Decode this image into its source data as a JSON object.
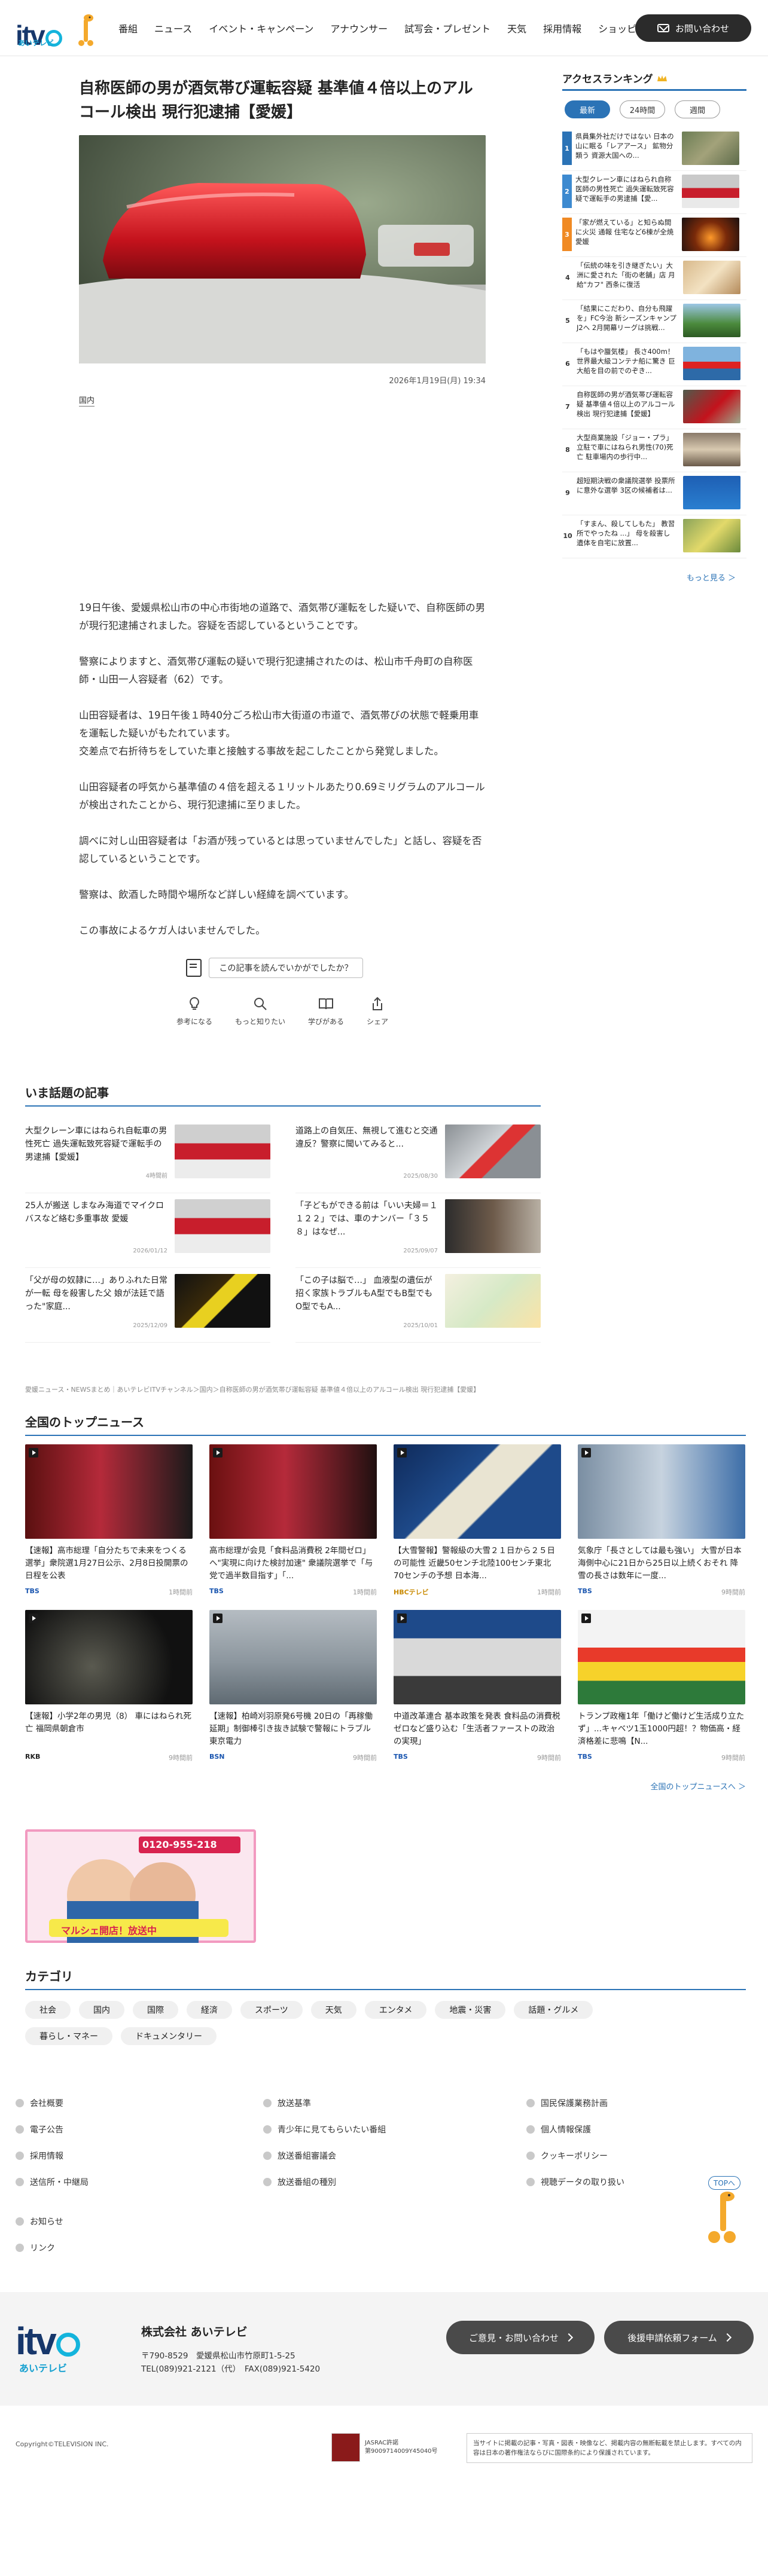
{
  "header": {
    "logo_text": "itv",
    "logo_sub": "あいテレビ",
    "nav": [
      "番組",
      "ニュース",
      "イベント・キャンペーン",
      "アナウンサー",
      "試写会・プレゼント",
      "天気",
      "採用情報",
      "ショッピング"
    ],
    "contact_label": "お問い合わせ"
  },
  "article": {
    "title": "自称医師の男が酒気帯び運転容疑 基準値４倍以上のアルコール検出 現行犯逮捕【愛媛】",
    "date": "2026年1月19日(月) 19:34",
    "category": "国内",
    "paragraphs": [
      "19日午後、愛媛県松山市の中心市街地の道路で、酒気帯び運転をした疑いで、自称医師の男が現行犯逮捕されました。容疑を否認しているということです。",
      "警察によりますと、酒気帯び運転の疑いで現行犯逮捕されたのは、松山市千舟町の自称医師・山田一人容疑者（62）です。",
      "山田容疑者は、19日午後１時40分ごろ松山市大街道の市道で、酒気帯びの状態で軽乗用車を運転した疑いがもたれています。\n交差点で右折待ちをしていた車と接触する事故を起こしたことから発覚しました。",
      "山田容疑者の呼気から基準値の４倍を超える１リットルあたり0.69ミリグラムのアルコールが検出されたことから、現行犯逮捕に至りました。",
      "調べに対し山田容疑者は「お酒が残っているとは思っていませんでした」と話し、容疑を否認しているということです。",
      "警察は、飲酒した時間や場所など詳しい経緯を調べています。",
      "この事故によるケガ人はいませんでした。"
    ],
    "feedback_question": "この記事を読んでいかがでしたか？",
    "feedback_options": [
      "参考になる",
      "もっと知りたい",
      "学びがある",
      "シェア"
    ]
  },
  "sidebar": {
    "title": "アクセスランキング",
    "tabs": [
      "最新",
      "24時間",
      "週間"
    ],
    "ranking": [
      {
        "num": "1",
        "text": "県員集外社だけではない 日本の山に眠る「レアアース」 鉱物分類う 資源大国への..."
      },
      {
        "num": "2",
        "text": "大型クレーン車にはねられ自称医師の男性死亡 過失運転致死容疑で運転手の男逮捕【愛..."
      },
      {
        "num": "3",
        "text": "「家が燃えている」と知らぬ間に火災 通報 住宅など6棟が全焼 愛媛"
      },
      {
        "num": "4",
        "text": "「伝統の味を引き継ぎたい」大洲に愛された「街の老舗」店 月給\"カフ\" 西条に復活"
      },
      {
        "num": "5",
        "text": "「結果にこだわり、自分も飛躍を」FC今治 新シーズンキャンプ J2へ 2月開幕リーグは挑戦..."
      },
      {
        "num": "6",
        "text": "「もはや蜃気楼」 長さ400m！ 世界最大級コンテナ船に驚き 巨大船を目の前でのぞき..."
      },
      {
        "num": "7",
        "text": "自称医師の男が酒気帯び運転容疑 基準値４倍以上のアルコール検出 現行犯逮捕【愛媛】"
      },
      {
        "num": "8",
        "text": "大型商業施設「ジョー・プラ」 立駐で車にはねられ男性(70)死亡 駐車場内の歩行中..."
      },
      {
        "num": "9",
        "text": "超短期決戦の衆議院選挙 投票所に意外な選挙 3区の候補者は..."
      },
      {
        "num": "10",
        "text": "「すまん、殺してしもた」 教習所でやったね ...」 母を殺害し 遺体を自宅に放置..."
      }
    ],
    "more_label": "もっと見る ＞"
  },
  "trending": {
    "title": "いま話題の記事",
    "items": [
      {
        "text": "大型クレーン車にはねられ自転車の男性死亡 過失運転致死容疑で運転手の男逮捕【愛媛】",
        "date": "4時間前"
      },
      {
        "text": "道路上の自気圧、無視して進むと交通違反？警察に聞いてみると...",
        "date": "2025/08/30"
      },
      {
        "text": "25人が搬送 しまなみ海道でマイクロバスなど絡む多重事故 愛媛",
        "date": "2026/01/12"
      },
      {
        "text": "「子どもができる前は「いい夫婦＝１１２２」では、車のナンバー「３５８」はなぜ...",
        "date": "2025/09/07"
      },
      {
        "text": "「父が母の奴隷に…」ありふれた日常が一転 母を殺害した父 娘が法廷で語った\"家庭...",
        "date": "2025/12/09"
      },
      {
        "text": "「この子は脳で…」 血液型の遺伝が招く家族トラブルもA型でもB型でもO型でもA...",
        "date": "2025/10/01"
      }
    ]
  },
  "breadcrumb": "愛媛ニュース・NEWSまとめ｜あいテレビITVチャンネル＞国内＞自称医師の男が酒気帯び運転容疑 基準値４倍以上のアルコール検出 現行犯逮捕【愛媛】",
  "topnews": {
    "title": "全国のトップニュース",
    "items": [
      {
        "text": "【速報】高市総理「自分たちで未来をつくる選挙」衆院選1月27日公示、2月8日投開票の日程を公表",
        "source": "TBS",
        "time": "1時間前"
      },
      {
        "text": "高市総理が会見「食料品消費税 2年間ゼロ」へ\"実現に向けた検討加速\" 衆議院選挙で「与党で過半数目指す」「...",
        "source": "TBS",
        "time": "1時間前"
      },
      {
        "text": "【大雪警報】警報級の大雪２１日から２５日の可能性 近畿50センチ北陸100センチ東北70センチの予想 日本海...",
        "source": "HBCテレビ",
        "time": "1時間前"
      },
      {
        "text": "気象庁「長さとしては最も強い」 大雪が日本海側中心に21日から25日以上続くおそれ 降雪の長さは数年に一度...",
        "source": "TBS",
        "time": "9時間前"
      },
      {
        "text": "【速報】小学2年の男児（8） 車にはねられ死亡 福岡県朝倉市",
        "source": "RKB",
        "time": "9時間前"
      },
      {
        "text": "【速報】柏崎刈羽原発6号機 20日の「再稼働延期」制御棒引き抜き試験で警報にトラブル 東京電力",
        "source": "BSN",
        "time": "9時間前"
      },
      {
        "text": "中道改革連合 基本政策を発表 食料品の消費税ゼロなど盛り込む「生活者ファーストの政治の実現」",
        "source": "TBS",
        "time": "9時間前"
      },
      {
        "text": "トランプ政権1年「働けど働けど生活成り立たず」...キャベツ1玉1000円超！？物価高・経済格差に悲鳴【N...",
        "source": "TBS",
        "time": "9時間前"
      }
    ],
    "more_label": "全国のトップニュースへ ＞"
  },
  "banner": {
    "phone": "0120-955-218",
    "text": "マルシェ開店！放送中"
  },
  "categories": {
    "title": "カテゴリ",
    "items": [
      "社会",
      "国内",
      "国際",
      "経済",
      "スポーツ",
      "天気",
      "エンタメ",
      "地震・災害",
      "話題・グルメ",
      "暮らし・マネー",
      "ドキュメンタリー"
    ]
  },
  "footer": {
    "links": [
      "会社概要",
      "放送基準",
      "国民保護業務計画",
      "電子公告",
      "青少年に見てもらいたい番組",
      "個人情報保護",
      "採用情報",
      "放送番組審議会",
      "クッキーポリシー",
      "送信所・中継局",
      "放送番組の種別",
      "視聴データの取り扱い"
    ],
    "links2": [
      "お知らせ",
      "リンク"
    ],
    "top_label": "TOPへ",
    "company_name": "株式会社 あいテレビ",
    "address": [
      "〒790-8529　愛媛県松山市竹原町1-5-25",
      "TEL(089)921-2121（代）　FAX(089)921-5420"
    ],
    "buttons": [
      "ご意見・お問い合わせ",
      "後援申請依頼フォーム"
    ],
    "copyright": "Copyright©TELEVISION INC.",
    "jasrac": [
      "JASRAC許諾",
      "第9009714009Y45040号"
    ],
    "notice": "当サイトに掲載の記事・写真・図表・映像など、掲載内容の無断転載を禁止します。すべての内容は日本の著作権法ならびに国際条約により保護されています。"
  },
  "colors": {
    "accent": "#2b73b6",
    "navy": "#17376b",
    "cyan": "#14b4dc",
    "dark": "#2b2b2b"
  }
}
